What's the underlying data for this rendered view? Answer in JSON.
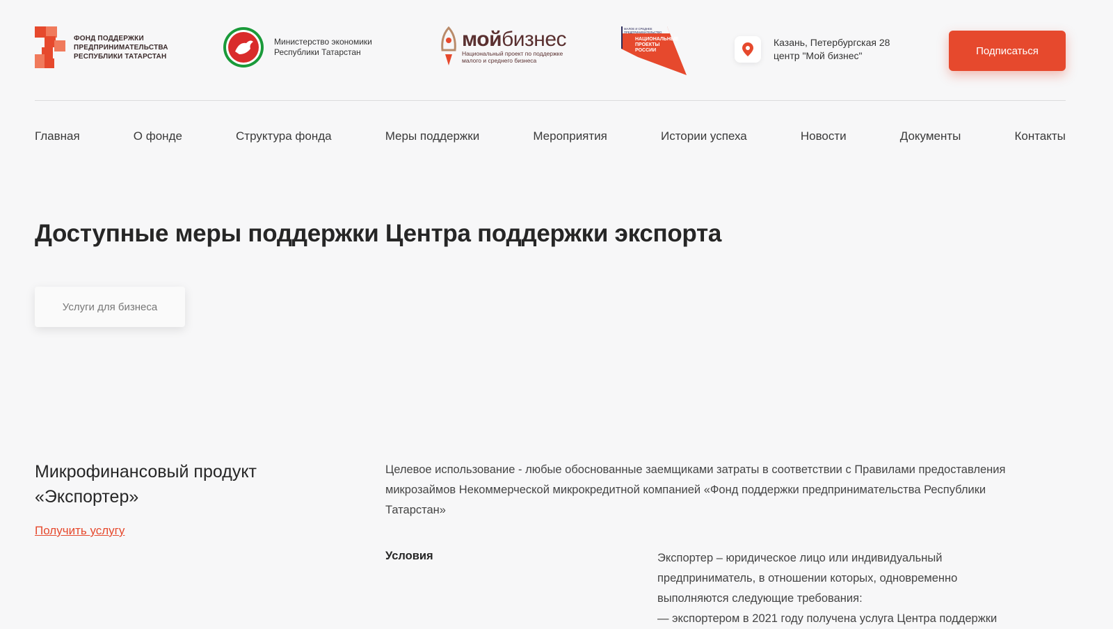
{
  "header": {
    "fund_logo_lines": [
      "ФОНД ПОДДЕРЖКИ",
      "ПРЕДПРИНИМАТЕЛЬСТВА",
      "РЕСПУБЛИКИ ТАТАРСТАН"
    ],
    "ministry_lines": [
      "Министерство экономики",
      "Республики Татарстан"
    ],
    "moy_biznes": {
      "brand_bold": "мой",
      "brand_rest": "бизнес",
      "sub_lines": [
        "Национальный проект по поддержке",
        "малого и среднего бизнеса"
      ]
    },
    "national_projects_lines": [
      "МАЛОЕ И СРЕДНЕЕ",
      "ПРЕДПРИНИМАТЕЛЬСТВО",
      "НАЦИОНАЛЬНЫЕ",
      "ПРОЕКТЫ",
      "РОССИИ"
    ],
    "location_lines": [
      "Казань, Петербургская 28",
      "центр \"Мой бизнес\""
    ],
    "subscribe_label": "Подписаться"
  },
  "nav": {
    "items": [
      {
        "label": "Главная"
      },
      {
        "label": "О фонде"
      },
      {
        "label": "Структура фонда"
      },
      {
        "label": "Меры поддержки"
      },
      {
        "label": "Мероприятия"
      },
      {
        "label": "Истории успеха"
      },
      {
        "label": "Новости"
      },
      {
        "label": "Документы"
      },
      {
        "label": "Контакты"
      }
    ]
  },
  "main": {
    "title": "Доступные меры поддержки Центра поддержки экспорта",
    "tab_label": "Услуги для бизнеса",
    "product": {
      "title": "Микрофинансовый продукт «Экспортер»",
      "link_label": "Получить услугу",
      "description": "Целевое использование - любые обоснованные заемщиками затраты в соответствии с Правилами предоставления микрозаймов Некоммерческой микрокредитной компанией «Фонд поддержки предпринимательства Республики Татарстан»",
      "conditions_label": "Условия",
      "conditions_lines": [
        "Экспортер – юридическое лицо или индивидуальный",
        "предприниматель, в отношении которых, одновременно",
        "выполняются следующие требования:",
        "— экспортером в 2021 году получена услуга Центра поддержки"
      ]
    }
  },
  "colors": {
    "accent": "#e6492d",
    "background": "#f7f7f8",
    "text": "#262626"
  }
}
